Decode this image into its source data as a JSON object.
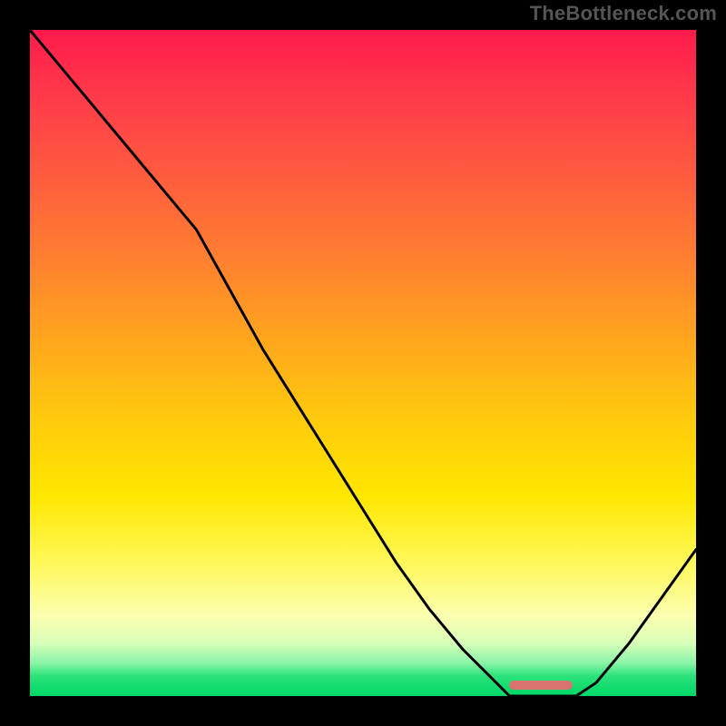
{
  "watermark": "TheBottleneck.com",
  "colors": {
    "curve_stroke": "#000000",
    "marker_fill": "#d9736f",
    "plot_border": "#000000",
    "bg": "#000000"
  },
  "marker": {
    "x_frac": 0.72,
    "width_frac": 0.095,
    "y_frac": 0.983
  },
  "chart_data": {
    "type": "line",
    "title": "",
    "xlabel": "",
    "ylabel": "",
    "x": [
      0.0,
      0.05,
      0.1,
      0.15,
      0.2,
      0.25,
      0.3,
      0.35,
      0.4,
      0.45,
      0.5,
      0.55,
      0.6,
      0.65,
      0.7,
      0.72,
      0.77,
      0.82,
      0.85,
      0.9,
      0.95,
      1.0
    ],
    "y": [
      1.0,
      0.94,
      0.88,
      0.82,
      0.76,
      0.7,
      0.61,
      0.52,
      0.44,
      0.36,
      0.28,
      0.2,
      0.13,
      0.07,
      0.02,
      0.0,
      0.0,
      0.0,
      0.02,
      0.08,
      0.15,
      0.22
    ],
    "xlim": [
      0,
      1
    ],
    "ylim": [
      0,
      1
    ],
    "annotations": [
      {
        "type": "highlight_band",
        "x_start": 0.72,
        "x_end": 0.815,
        "y": 0.0
      }
    ],
    "background": "vertical_gradient_red_to_green",
    "grid": false,
    "legend": false
  }
}
